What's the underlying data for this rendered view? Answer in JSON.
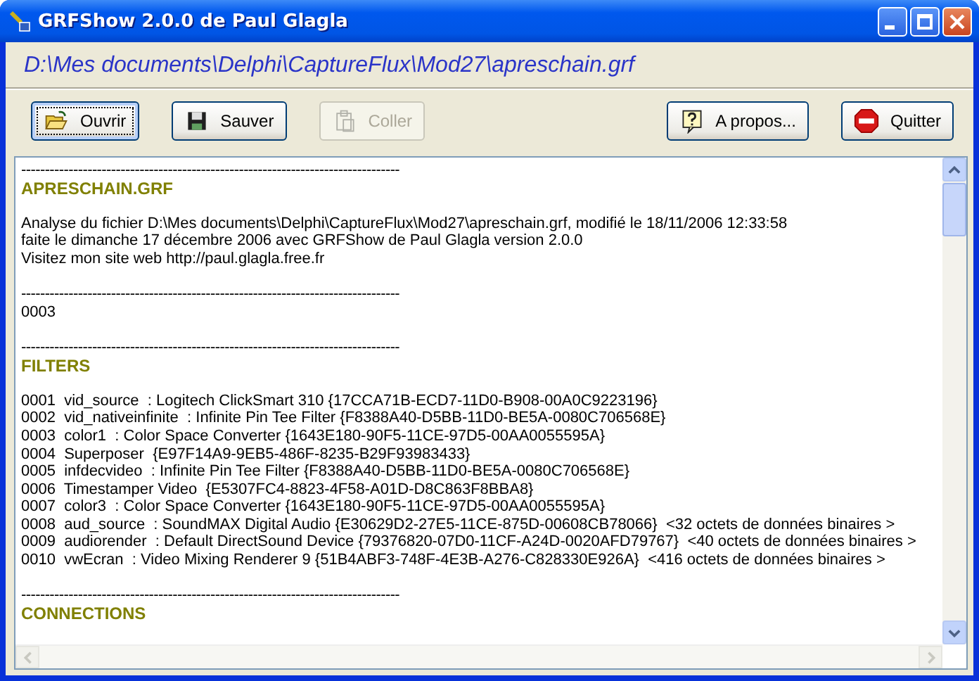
{
  "window": {
    "title": "GRFShow 2.0.0 de Paul Glagla"
  },
  "path": "D:\\Mes documents\\Delphi\\CaptureFlux\\Mod27\\apreschain.grf",
  "toolbar_left": [
    {
      "label": "Ouvrir",
      "kind": "open",
      "disabled": false,
      "focused": true
    },
    {
      "label": "Sauver",
      "kind": "save",
      "disabled": false,
      "focused": false
    },
    {
      "label": "Coller",
      "kind": "paste",
      "disabled": true,
      "focused": false
    }
  ],
  "toolbar_right": [
    {
      "label": "A propos...",
      "kind": "help",
      "disabled": false,
      "focused": false
    },
    {
      "label": "Quitter",
      "kind": "stop",
      "disabled": false,
      "focused": false
    }
  ],
  "document": [
    {
      "kind": "rule",
      "text": "--------------------------------------------------------------------------------"
    },
    {
      "kind": "heading",
      "text": "APRESCHAIN.GRF"
    },
    {
      "kind": "blank"
    },
    {
      "kind": "text",
      "text": "Analyse du fichier D:\\Mes documents\\Delphi\\CaptureFlux\\Mod27\\apreschain.grf, modifié le 18/11/2006 12:33:58"
    },
    {
      "kind": "text",
      "text": "faite le dimanche 17 décembre 2006 avec GRFShow de Paul Glagla version 2.0.0"
    },
    {
      "kind": "text",
      "text": "Visitez mon site web http://paul.glagla.free.fr"
    },
    {
      "kind": "blank"
    },
    {
      "kind": "rule",
      "text": "--------------------------------------------------------------------------------"
    },
    {
      "kind": "text",
      "text": "0003"
    },
    {
      "kind": "blank"
    },
    {
      "kind": "rule",
      "text": "--------------------------------------------------------------------------------"
    },
    {
      "kind": "heading",
      "text": "FILTERS"
    },
    {
      "kind": "blank"
    },
    {
      "kind": "text",
      "text": "0001  vid_source  : Logitech ClickSmart 310 {17CCA71B-ECD7-11D0-B908-00A0C9223196}"
    },
    {
      "kind": "text",
      "text": "0002  vid_nativeinfinite  : Infinite Pin Tee Filter {F8388A40-D5BB-11D0-BE5A-0080C706568E}"
    },
    {
      "kind": "text",
      "text": "0003  color1  : Color Space Converter {1643E180-90F5-11CE-97D5-00AA0055595A}"
    },
    {
      "kind": "text",
      "text": "0004  Superposer  {E97F14A9-9EB5-486F-8235-B29F93983433}"
    },
    {
      "kind": "text",
      "text": "0005  infdecvideo  : Infinite Pin Tee Filter {F8388A40-D5BB-11D0-BE5A-0080C706568E}"
    },
    {
      "kind": "text",
      "text": "0006  Timestamper Video  {E5307FC4-8823-4F58-A01D-D8C863F8BBA8}"
    },
    {
      "kind": "text",
      "text": "0007  color3  : Color Space Converter {1643E180-90F5-11CE-97D5-00AA0055595A}"
    },
    {
      "kind": "text",
      "text": "0008  aud_source  : SoundMAX Digital Audio {E30629D2-27E5-11CE-875D-00608CB78066}  <32 octets de données binaires >"
    },
    {
      "kind": "text",
      "text": "0009  audiorender  : Default DirectSound Device {79376820-07D0-11CF-A24D-0020AFD79767}  <40 octets de données binaires >"
    },
    {
      "kind": "text",
      "text": "0010  vwEcran  : Video Mixing Renderer 9 {51B4ABF3-748F-4E3B-A276-C828330E926A}  <416 octets de données binaires >"
    },
    {
      "kind": "blank"
    },
    {
      "kind": "rule",
      "text": "--------------------------------------------------------------------------------"
    },
    {
      "kind": "heading",
      "text": "CONNECTIONS"
    }
  ]
}
